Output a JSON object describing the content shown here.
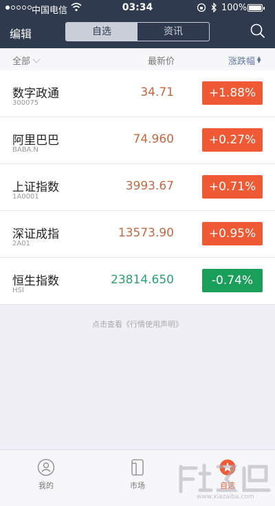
{
  "status_bar": {
    "carrier": "中国电信",
    "time": "03:34",
    "battery": "100%"
  },
  "nav": {
    "edit_label": "编辑",
    "segments": [
      "自选",
      "资讯"
    ],
    "search_icon": "search-icon"
  },
  "columns": {
    "all_label": "全部",
    "price_label": "最新价",
    "change_label": "涨跌幅"
  },
  "stocks": [
    {
      "name": "数字政通",
      "code": "300075",
      "price": "34.71",
      "change": "+1.88%",
      "direction": "up"
    },
    {
      "name": "阿里巴巴",
      "code": "BABA.N",
      "price": "74.960",
      "change": "+0.27%",
      "direction": "up"
    },
    {
      "name": "上证指数",
      "code": "1A0001",
      "price": "3993.67",
      "change": "+0.71%",
      "direction": "up"
    },
    {
      "name": "深证成指",
      "code": "2A01",
      "price": "13573.90",
      "change": "+0.95%",
      "direction": "up"
    },
    {
      "name": "恒生指数",
      "code": "HSI",
      "price": "23814.650",
      "change": "-0.74%",
      "direction": "down"
    }
  ],
  "disclaimer": "点击查看《行情使用声明》",
  "tabbar": {
    "items": [
      {
        "label": "我的",
        "icon": "user-icon"
      },
      {
        "label": "市场",
        "icon": "market-icon"
      },
      {
        "label": "自选",
        "icon": "star-icon"
      }
    ]
  },
  "watermark": "www.xiazaiba.com",
  "colors": {
    "header_bg": "#2f3a4e",
    "up": "#ef5a34",
    "down": "#1a9f5b",
    "sort_accent": "#5f79a0"
  }
}
